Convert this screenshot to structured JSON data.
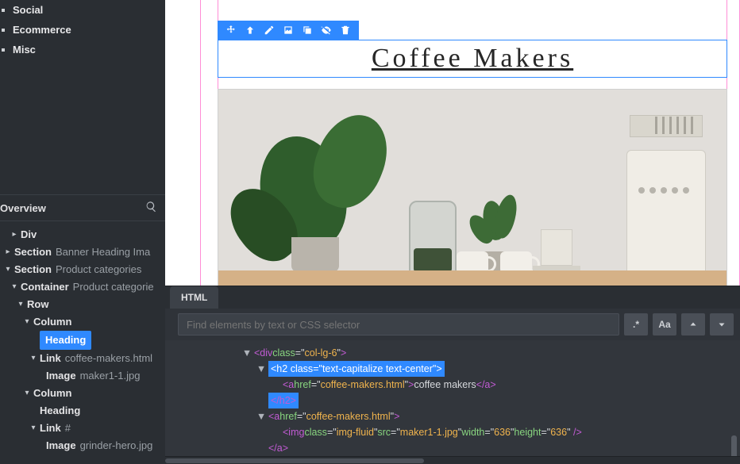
{
  "sidebar": {
    "block_groups": [
      "Social",
      "Ecommerce",
      "Misc"
    ],
    "overview_label": "Overview",
    "tree": [
      {
        "indent": 1,
        "toggle": "▸",
        "label": "Div",
        "sub": ""
      },
      {
        "indent": 0,
        "toggle": "▸",
        "label": "Section",
        "sub": "Banner Heading Ima"
      },
      {
        "indent": 0,
        "toggle": "▾",
        "label": "Section",
        "sub": "Product categories"
      },
      {
        "indent": 1,
        "toggle": "▾",
        "label": "Container",
        "sub": "Product categorie"
      },
      {
        "indent": 2,
        "toggle": "▾",
        "label": "Row",
        "sub": ""
      },
      {
        "indent": 3,
        "toggle": "▾",
        "label": "Column",
        "sub": ""
      },
      {
        "indent": 4,
        "toggle": "",
        "label": "Heading",
        "sub": "",
        "selected": true
      },
      {
        "indent": 4,
        "toggle": "▾",
        "label": "Link",
        "sub": "coffee-makers.html"
      },
      {
        "indent": 5,
        "toggle": "",
        "label": "Image",
        "sub": "maker1-1.jpg"
      },
      {
        "indent": 3,
        "toggle": "▾",
        "label": "Column",
        "sub": ""
      },
      {
        "indent": 4,
        "toggle": "",
        "label": "Heading",
        "sub": ""
      },
      {
        "indent": 4,
        "toggle": "▾",
        "label": "Link",
        "sub": "#"
      },
      {
        "indent": 5,
        "toggle": "",
        "label": "Image",
        "sub": "grinder-hero.jpg"
      }
    ]
  },
  "canvas": {
    "heading_text": "Coffee Makers"
  },
  "bottom": {
    "tab_label": "HTML",
    "search_placeholder": "Find elements by text or CSS selector",
    "btn_regex": ".*",
    "btn_case": "Aa",
    "code": {
      "div_class": "col-lg-6",
      "h2_class": "text-capitalize text-center",
      "href": "coffee-makers.html",
      "link_text": "coffee makers",
      "img_class": "img-fluid",
      "img_src": "maker1-1.jpg",
      "img_w": "636",
      "img_h": "636"
    }
  }
}
